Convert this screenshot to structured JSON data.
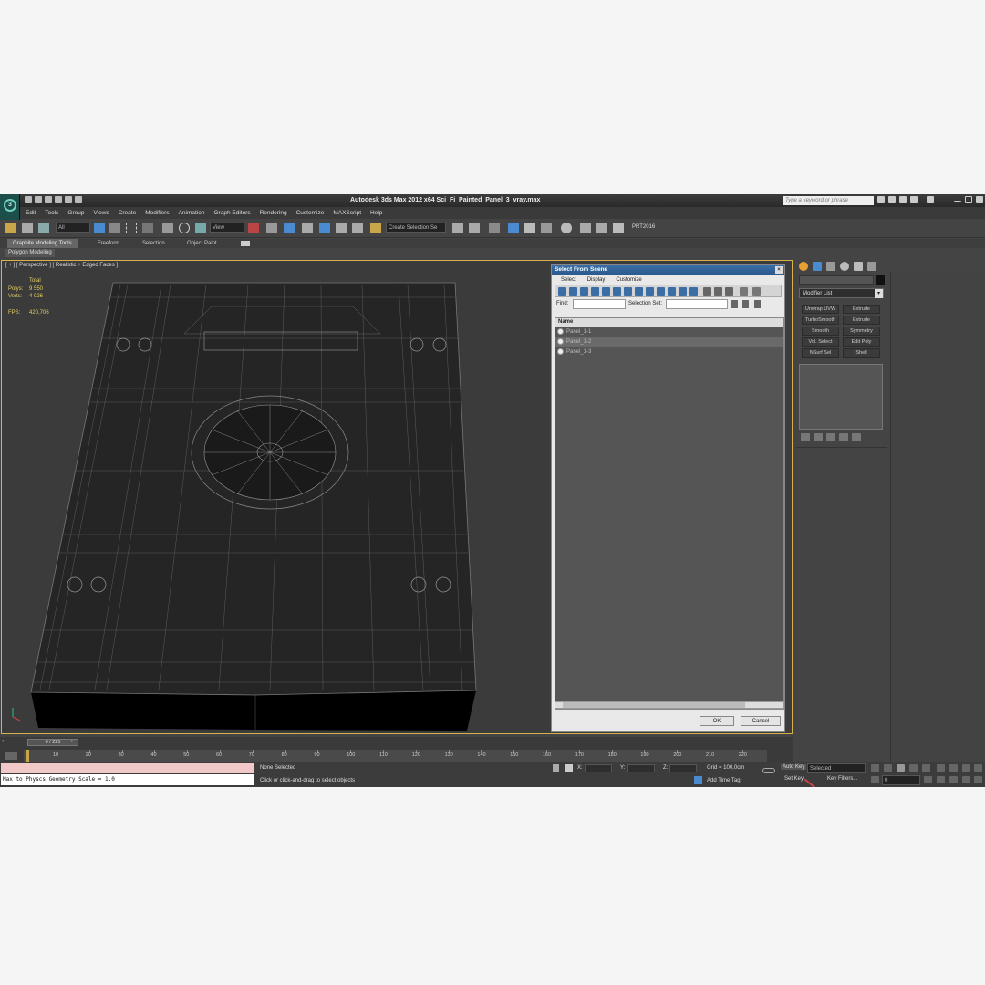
{
  "app": {
    "logo_text": "3",
    "title": "Autodesk 3ds Max  2012 x64     Sci_Fi_Painted_Panel_3_vray.max",
    "search_placeholder": "Type a keyword or phrase"
  },
  "menu": [
    "Edit",
    "Tools",
    "Group",
    "Views",
    "Create",
    "Modifiers",
    "Animation",
    "Graph Editors",
    "Rendering",
    "Customize",
    "MAXScript",
    "Help"
  ],
  "toolbar": {
    "selection_filter": "All",
    "ref_coord": "View",
    "named_selection": "Create Selection Se",
    "prt_label": "PRT2016"
  },
  "ribbon": {
    "tabs": [
      "Graphite Modeling Tools",
      "Freeform",
      "Selection",
      "Object Paint"
    ],
    "subtab": "Polygon Modeling"
  },
  "viewport": {
    "label": "[ + ] [ Perspective ] [ Realistic + Edged Faces ]",
    "stats_header": "Total",
    "stats": [
      {
        "key": "Polys:",
        "value": "9 550"
      },
      {
        "key": "Verts:",
        "value": "4 926"
      }
    ],
    "fps_key": "FPS:",
    "fps_value": "420,706"
  },
  "dialog": {
    "title": "Select From Scene",
    "menu": [
      "Select",
      "Display",
      "Customize"
    ],
    "find_label": "Find:",
    "selection_set_label": "Selection Set:",
    "column_header": "Name",
    "items": [
      "Panel_1-1",
      "Panel_1-2",
      "Panel_1-3"
    ],
    "selected_index": 1,
    "ok": "OK",
    "cancel": "Cancel"
  },
  "command_panel": {
    "modifier_list": "Modifier List",
    "modifiers": [
      "Unwrap UVW",
      "Extrude",
      "TurboSmooth",
      "Extrude",
      "Smooth",
      "Symmetry",
      "Vol. Select",
      "Edit Poly",
      "NSurf Sel",
      "Shell"
    ]
  },
  "timeline": {
    "frame": "0 / 225",
    "ticks": [
      "10",
      "20",
      "30",
      "40",
      "50",
      "60",
      "70",
      "80",
      "90",
      "100",
      "110",
      "120",
      "130",
      "140",
      "150",
      "160",
      "170",
      "180",
      "190",
      "200",
      "210",
      "220"
    ]
  },
  "status": {
    "maxscript": "Max to Physcs Geometry Scale = 1.0",
    "selection": "None Selected",
    "prompt": "Click or click-and-drag to select objects",
    "x_label": "X:",
    "y_label": "Y:",
    "z_label": "Z:",
    "grid": "Grid = 100,0cm",
    "add_time_tag": "Add Time Tag",
    "auto_key": "Auto Key",
    "set_key": "Set Key",
    "key_mode": "Selected",
    "key_filters": "Key Filters...",
    "frame_field": "0"
  },
  "colors": {
    "viewport_border": "#d6b24a",
    "stats": "#e6d060",
    "dialog_title": "#3a6ea5"
  }
}
